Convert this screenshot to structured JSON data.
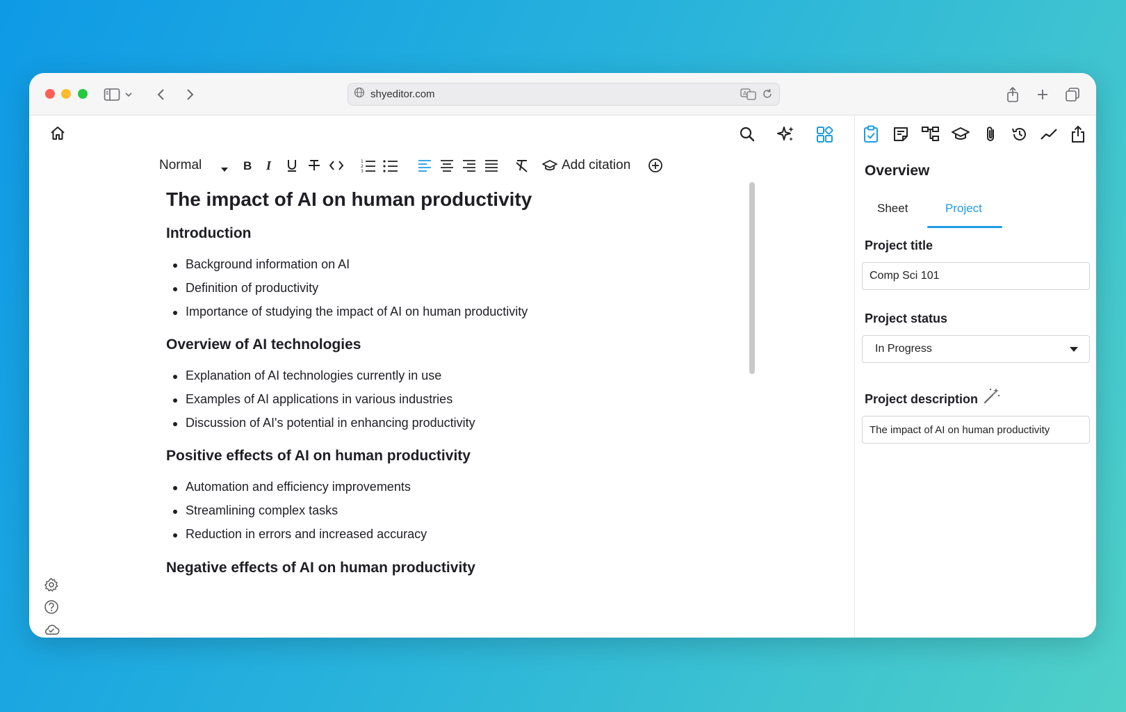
{
  "browser": {
    "url": "shyeditor.com"
  },
  "toolbar": {
    "style_select": "Normal",
    "add_citation": "Add citation"
  },
  "document": {
    "title": "The impact of AI on human productivity",
    "sections": [
      {
        "heading": "Introduction",
        "items": [
          "Background information on AI",
          "Definition of productivity",
          "Importance of studying the impact of AI on human productivity"
        ]
      },
      {
        "heading": "Overview of AI technologies",
        "items": [
          "Explanation of AI technologies currently in use",
          "Examples of AI applications in various industries",
          "Discussion of AI's potential in enhancing productivity"
        ]
      },
      {
        "heading": "Positive effects of AI on human productivity",
        "items": [
          "Automation and efficiency improvements",
          "Streamlining complex tasks",
          "Reduction in errors and increased accuracy"
        ]
      },
      {
        "heading": "Negative effects of AI on human productivity",
        "items": []
      }
    ]
  },
  "panel": {
    "title": "Overview",
    "tabs": [
      "Sheet",
      "Project"
    ],
    "active_tab": "Project",
    "project_title_label": "Project title",
    "project_title_value": "Comp Sci 101",
    "project_status_label": "Project status",
    "project_status_value": "In Progress",
    "project_description_label": "Project description",
    "project_description_value": "The impact of AI on human productivity"
  },
  "colors": {
    "accent": "#1e9be6"
  }
}
